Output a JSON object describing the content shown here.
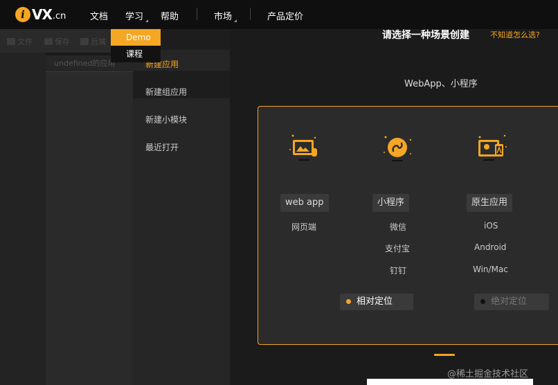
{
  "nav": {
    "logo_mark": "i",
    "logo_text": "VX",
    "logo_domain": ".cn",
    "items": [
      "文档",
      "学习",
      "帮助",
      "市场",
      "产品定价"
    ]
  },
  "dropdown": [
    "Demo",
    "课程"
  ],
  "editor": {
    "toolbar": [
      "文件",
      "保存",
      "后端"
    ],
    "tab": "undefined的应用"
  },
  "modal": {
    "title": "请选择一种场景创建",
    "title_link": "不知道怎么选?",
    "sidebar": [
      "新建应用",
      "新建组应用",
      "新建小模块",
      "最近打开"
    ],
    "section_title": "WebApp、小程序",
    "columns": [
      {
        "icon": "monitor-icon",
        "tag": "web app",
        "subs": [
          "网页端"
        ]
      },
      {
        "icon": "mini-program-icon",
        "tag": "小程序",
        "subs": [
          "微信",
          "支付宝",
          "钉钉"
        ]
      },
      {
        "icon": "native-app-icon",
        "tag": "原生应用",
        "subs": [
          "iOS",
          "Android",
          "Win/Mac"
        ]
      }
    ],
    "positioning": {
      "relative": "相对定位",
      "absolute": "绝对定位"
    }
  },
  "watermark": "@稀土掘金技术社区",
  "colors": {
    "accent": "#f5a623",
    "background": "#1b1b1b",
    "card": "#2b2b2b"
  }
}
